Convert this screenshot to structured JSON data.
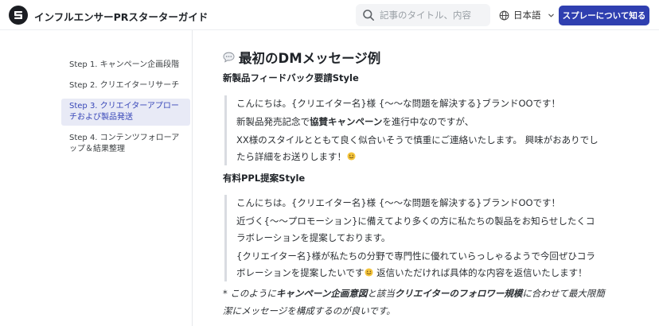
{
  "header": {
    "site_title": "インフルエンサーPRスターターガイド",
    "search_placeholder": "記事のタイトル、内容",
    "language": "日本語",
    "cta_label": "スプレーについて知る"
  },
  "sidebar": {
    "items": [
      {
        "label": "Step 1. キャンペーン企画段階"
      },
      {
        "label": "Step 2. クリエイターリサーチ"
      },
      {
        "label": "Step 3. クリエイターアプローチおよび製品発送"
      },
      {
        "label": "Step 4. コンテンツフォローアップ＆結果整理"
      }
    ]
  },
  "main": {
    "title": "最初のDMメッセージ例",
    "section1": {
      "heading": "新製品フィードバック要請Style",
      "line1": "こんにちは。{クリエイター名}様 {〜〜な問題を解決する}ブランドOOです！",
      "line2_pre": "新製品発売記念で",
      "line2_bold": "協賛キャンペーン",
      "line2_post": "を進行中なのですが、",
      "line3": "XX様のスタイルとともて良く似合いそうで慎重にご連絡いたします。 興味がおありでしたら詳細をお送りします！"
    },
    "section2": {
      "heading": "有料PPL提案Style",
      "line1": "こんにちは。{クリエイター名}様 {〜〜な問題を解決する}ブランドOOです！",
      "line2": "近づく{〜〜プロモーション}に備えてより多くの方に私たちの製品をお知らせしたくコラボレーションを提案しております。",
      "line3_pre": "{クリエイター名}様が私たちの分野で専門性に優れていらっしゃるようで今回ぜひコラボレーションを提案したいです",
      "line3_post": " 返信いただければ具体的な内容を返信いたします！"
    },
    "note": {
      "p1": "* このように",
      "b1": "キャンペーン企画意図",
      "p2": "と該当",
      "b2": "クリエイターのフォロワー規模",
      "p3": "に合わせて最大限簡潔にメッセージを構成するのが良いです。"
    }
  },
  "colors": {
    "accent": "#2f3fb0",
    "sidebar_active_bg": "#e8eaf6",
    "sidebar_active_text": "#3847b8"
  },
  "icons": [
    "logo-icon",
    "search-icon",
    "globe-icon",
    "chevron-down-icon",
    "speech-bubble-icon",
    "smile-icon"
  ]
}
